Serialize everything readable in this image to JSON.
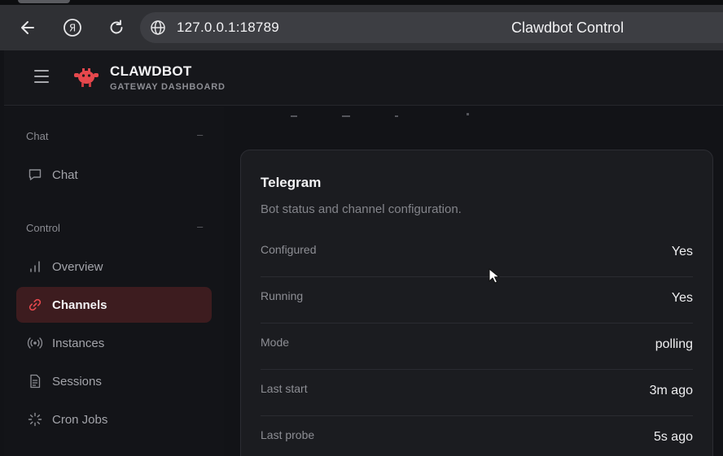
{
  "browser": {
    "url": "127.0.0.1:18789",
    "page_title": "Clawdbot Control"
  },
  "header": {
    "brand_name": "CLAWDBOT",
    "brand_subtitle": "GATEWAY DASHBOARD"
  },
  "sidebar": {
    "chat_section": {
      "title": "Chat",
      "collapse": "–",
      "items": [
        {
          "label": "Chat",
          "icon": "message-icon"
        }
      ]
    },
    "control_section": {
      "title": "Control",
      "collapse": "–",
      "items": [
        {
          "label": "Overview",
          "icon": "bar-chart-icon"
        },
        {
          "label": "Channels",
          "icon": "link-icon",
          "active": true
        },
        {
          "label": "Instances",
          "icon": "broadcast-icon"
        },
        {
          "label": "Sessions",
          "icon": "document-icon"
        },
        {
          "label": "Cron Jobs",
          "icon": "loader-icon"
        }
      ]
    }
  },
  "card": {
    "title": "Telegram",
    "subtitle": "Bot status and channel configuration.",
    "rows": [
      {
        "label": "Configured",
        "value": "Yes"
      },
      {
        "label": "Running",
        "value": "Yes"
      },
      {
        "label": "Mode",
        "value": "polling"
      },
      {
        "label": "Last start",
        "value": "3m ago"
      },
      {
        "label": "Last probe",
        "value": "5s ago"
      }
    ]
  },
  "colors": {
    "accent": "#e5484d",
    "active_bg": "#3d1c1f",
    "card_bg": "#1b1c20"
  }
}
